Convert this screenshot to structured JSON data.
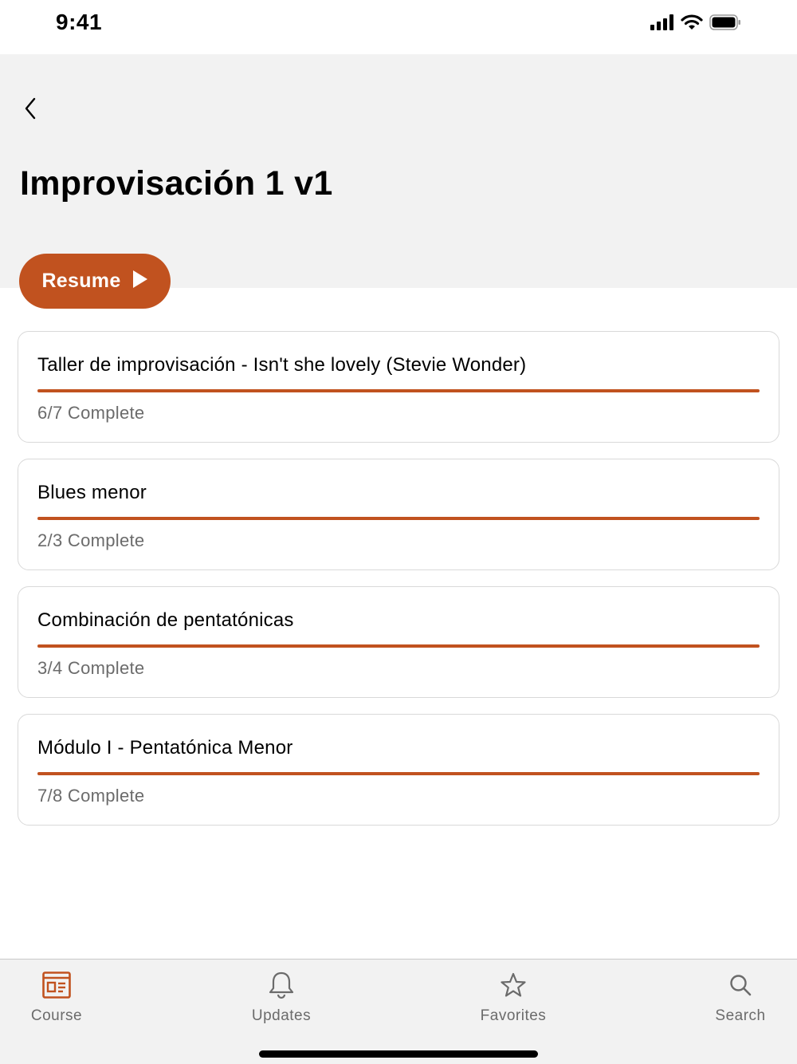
{
  "status_bar": {
    "time": "9:41"
  },
  "header": {
    "title": "Improvisación 1 v1"
  },
  "resume_button": {
    "label": "Resume"
  },
  "colors": {
    "accent": "#c1521f",
    "header_bg": "#f2f2f2",
    "muted_text": "#6b6b6b"
  },
  "modules": [
    {
      "title": "Taller de improvisación - Isn't she lovely (Stevie Wonder)",
      "status": "6/7 Complete",
      "progress": 1.0
    },
    {
      "title": "Blues menor",
      "status": "2/3 Complete",
      "progress": 1.0
    },
    {
      "title": "Combinación de pentatónicas",
      "status": "3/4 Complete",
      "progress": 1.0
    },
    {
      "title": "Módulo I - Pentatónica Menor",
      "status": "7/8 Complete",
      "progress": 1.0
    }
  ],
  "tabs": [
    {
      "label": "Course",
      "icon": "course-icon",
      "active": true
    },
    {
      "label": "Updates",
      "icon": "bell-icon",
      "active": false
    },
    {
      "label": "Favorites",
      "icon": "star-icon",
      "active": false
    },
    {
      "label": "Search",
      "icon": "search-icon",
      "active": false
    }
  ]
}
